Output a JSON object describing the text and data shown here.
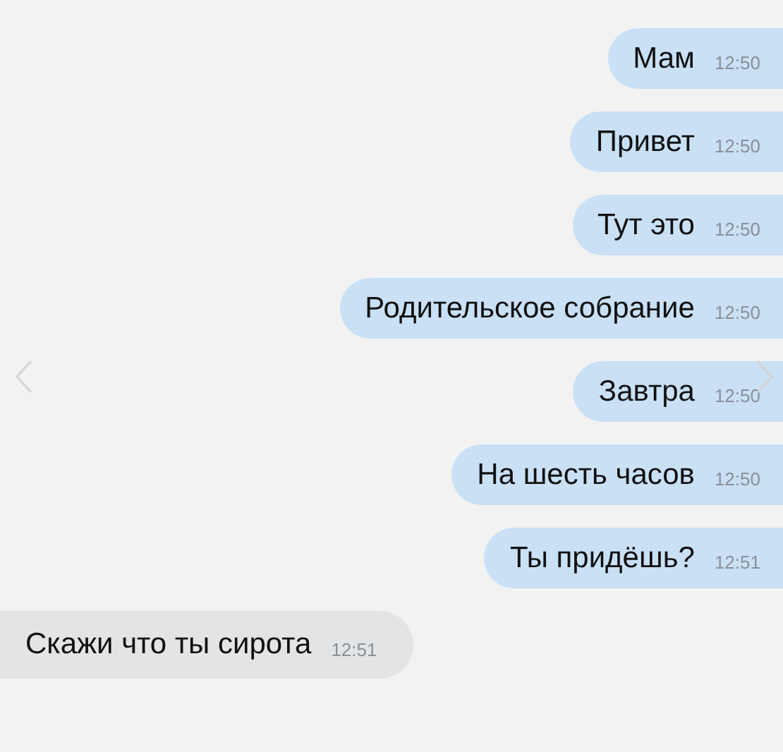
{
  "messages": [
    {
      "kind": "sent",
      "text": "Мам",
      "time": "12:50"
    },
    {
      "kind": "sent",
      "text": "Привет",
      "time": "12:50"
    },
    {
      "kind": "sent",
      "text": "Тут это",
      "time": "12:50"
    },
    {
      "kind": "sent",
      "text": "Родительское собрание",
      "time": "12:50"
    },
    {
      "kind": "sent",
      "text": "Завтра",
      "time": "12:50"
    },
    {
      "kind": "sent",
      "text": "На шесть часов",
      "time": "12:50"
    },
    {
      "kind": "sent",
      "text": "Ты придёшь?",
      "time": "12:51"
    },
    {
      "kind": "received",
      "text": "Скажи что ты сирота",
      "time": "12:51"
    }
  ]
}
